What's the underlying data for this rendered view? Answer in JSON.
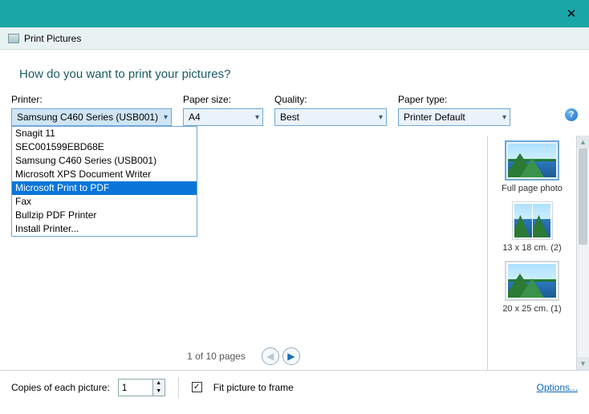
{
  "app": {
    "title": "Print Pictures"
  },
  "question": "How do you want to print your pictures?",
  "labels": {
    "printer": "Printer:",
    "paper_size": "Paper size:",
    "quality": "Quality:",
    "paper_type": "Paper type:",
    "copies": "Copies of each picture:",
    "fit": "Fit picture to frame",
    "options": "Options..."
  },
  "values": {
    "printer": "Samsung C460 Series (USB001)",
    "paper_size": "A4",
    "quality": "Best",
    "paper_type": "Printer Default",
    "copies": "1"
  },
  "dropdown": {
    "items": [
      "Snagit 11",
      "SEC001599EBD68E",
      "Samsung C460 Series (USB001)",
      "Microsoft XPS Document Writer",
      "Microsoft Print to PDF",
      "Fax",
      "Bullzip PDF Printer",
      "Install Printer..."
    ],
    "highlighted_index": 4
  },
  "pager": {
    "text": "1 of 10 pages"
  },
  "layouts": [
    {
      "caption": "Full page photo"
    },
    {
      "caption": "13 x 18 cm. (2)"
    },
    {
      "caption": "20 x 25 cm. (1)"
    }
  ],
  "fit_checked": true,
  "help_glyph": "?"
}
